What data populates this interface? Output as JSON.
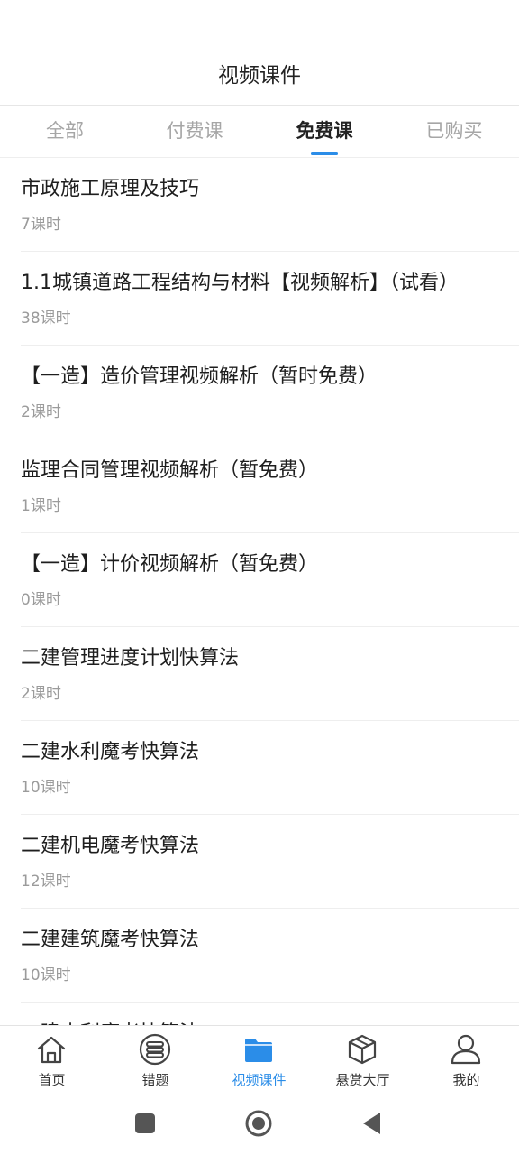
{
  "header": {
    "title": "视频课件"
  },
  "tabs": [
    {
      "label": "全部"
    },
    {
      "label": "付费课"
    },
    {
      "label": "免费课"
    },
    {
      "label": "已购买"
    }
  ],
  "active_tab": "免费课",
  "courses": [
    {
      "name": "市政施工原理及技巧",
      "count": "7课时"
    },
    {
      "name": "1.1城镇道路工程结构与材料【视频解析】（试看）",
      "count": "38课时"
    },
    {
      "name": "【一造】造价管理视频解析（暂时免费）",
      "count": "2课时"
    },
    {
      "name": "监理合同管理视频解析（暂免费）",
      "count": "1课时"
    },
    {
      "name": "【一造】计价视频解析（暂免费）",
      "count": "0课时"
    },
    {
      "name": "二建管理进度计划快算法",
      "count": "2课时"
    },
    {
      "name": "二建水利魔考快算法",
      "count": "10课时"
    },
    {
      "name": "二建机电魔考快算法",
      "count": "12课时"
    },
    {
      "name": "二建建筑魔考快算法",
      "count": "10课时"
    },
    {
      "name": "一建水利魔考快算法",
      "count": ""
    }
  ],
  "bottom_nav": [
    {
      "label": "首页",
      "icon": "home-icon"
    },
    {
      "label": "错题",
      "icon": "list-icon"
    },
    {
      "label": "视频课件",
      "icon": "folder-icon"
    },
    {
      "label": "悬赏大厅",
      "icon": "cube-icon"
    },
    {
      "label": "我的",
      "icon": "person-icon"
    }
  ],
  "active_nav": "视频课件",
  "colors": {
    "accent": "#2b8de8",
    "icon_gray": "#444444"
  },
  "system_nav": [
    {
      "icon": "recent-apps-icon"
    },
    {
      "icon": "home-circle-icon"
    },
    {
      "icon": "back-triangle-icon"
    }
  ]
}
